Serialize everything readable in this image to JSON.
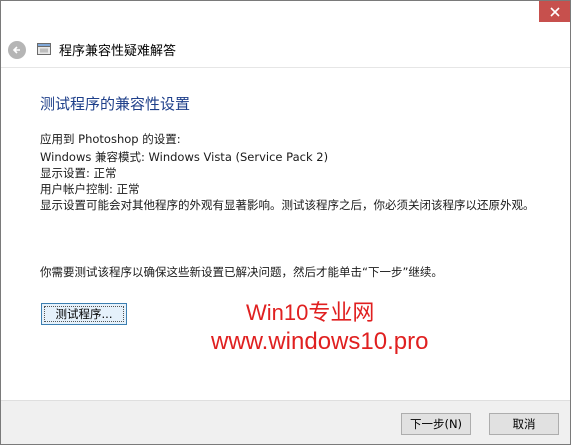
{
  "window": {
    "title": "程序兼容性疑难解答"
  },
  "content": {
    "heading": "测试程序的兼容性设置",
    "applied_to": "应用到 Photoshop 的设置:",
    "compat_mode": "Windows 兼容模式: Windows Vista (Service Pack 2)",
    "display": "显示设置: 正常",
    "uac": "用户帐户控制: 正常",
    "note": "显示设置可能会对其他程序的外观有显著影响。测试该程序之后，你必须关闭该程序以还原外观。",
    "instruction": "你需要测试该程序以确保这些新设置已解决问题，然后才能单击“下一步”继续。",
    "test_button": "测试程序..."
  },
  "watermark": {
    "line1": "Win10专业网",
    "line2": "www.windows10.pro"
  },
  "footer": {
    "next_label": "下一步(N)",
    "cancel_label": "取消"
  },
  "icons": {
    "close": "close-icon",
    "back": "back-arrow-icon",
    "app": "troubleshooter-icon"
  },
  "colors": {
    "heading": "#1e3f8a",
    "close_button": "#c7504d",
    "watermark": "#e02020"
  }
}
